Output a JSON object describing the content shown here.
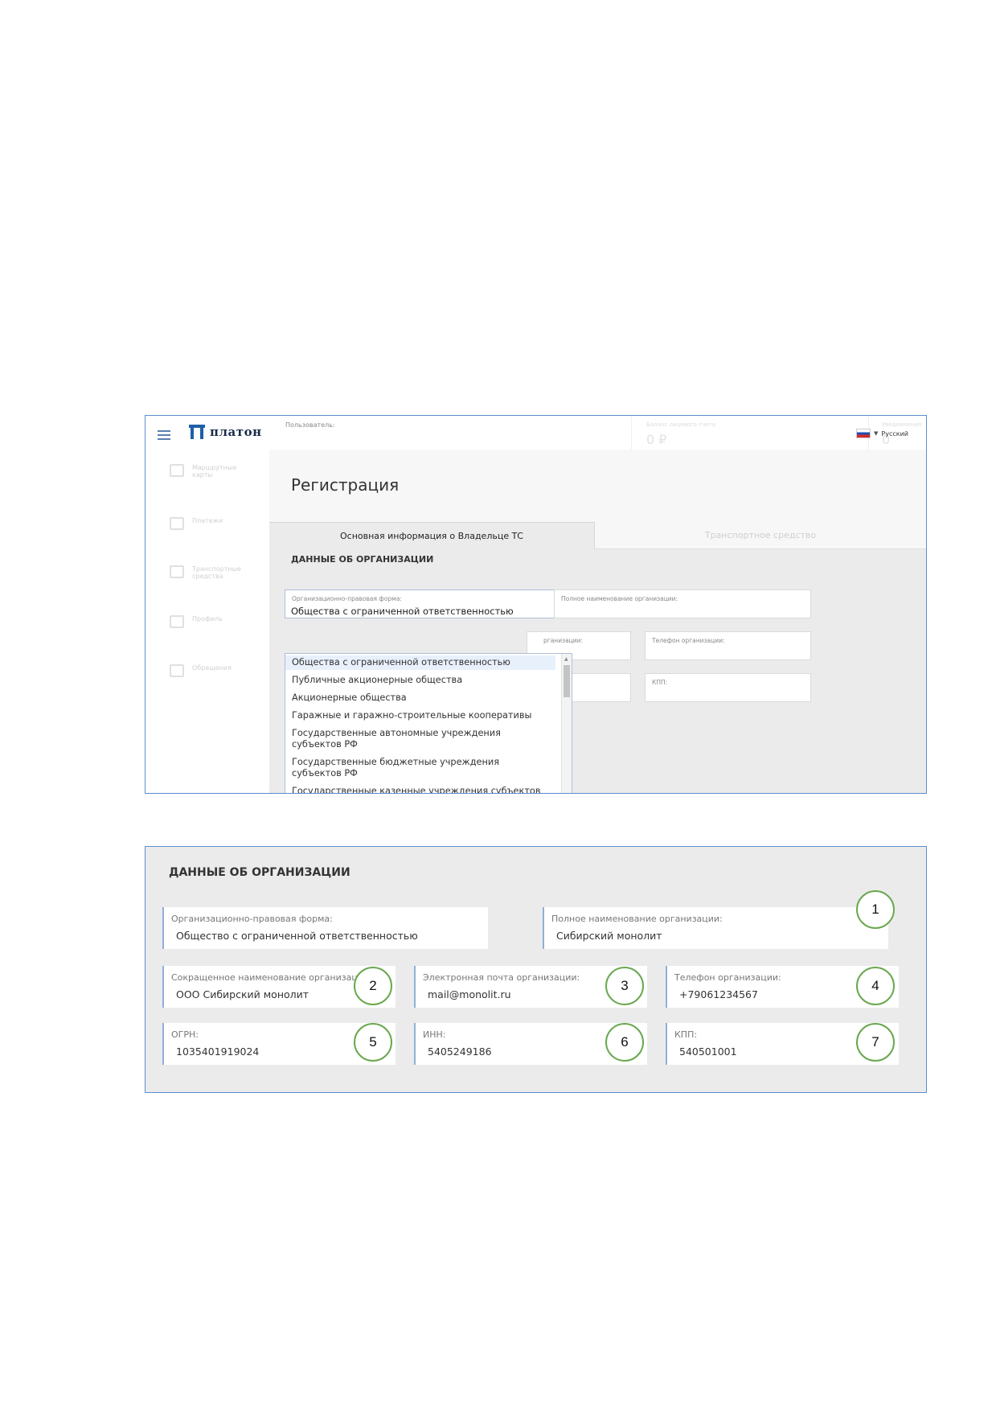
{
  "app": {
    "logo_text": "платон",
    "user_label": "Пользователь:",
    "balance_label": "Баланс лицевого счета",
    "balance_value": "0 ₽",
    "notifications_label": "Уведомления",
    "notifications_value": "0",
    "language": "Русский"
  },
  "sidebar": {
    "items": [
      {
        "label": "Маршрутные карты",
        "icon": "map-icon"
      },
      {
        "label": "Платежи",
        "icon": "wallet-icon"
      },
      {
        "label": "Транспортные средства",
        "icon": "truck-icon"
      },
      {
        "label": "Профиль",
        "icon": "profile-icon"
      },
      {
        "label": "Обращения",
        "icon": "message-icon"
      }
    ]
  },
  "page": {
    "title": "Регистрация",
    "tabs": [
      {
        "label": "Основная информация о Владельце ТС",
        "active": true
      },
      {
        "label": "Транспортное средство",
        "active": false
      }
    ],
    "section_title": "ДАННЫЕ ОБ ОРГАНИЗАЦИИ",
    "form": {
      "legal_form_label": "Организационно-правовая форма:",
      "legal_form_value": "Общества с ограниченной ответственностью",
      "full_name_label": "Полное наименование организации:",
      "email_label_partial": "рганизации:",
      "phone_label": "Телефон организации:",
      "kpp_label": "КПП:"
    },
    "dropdown_options": [
      "Общества с ограниченной ответственностью",
      "Публичные акционерные общества",
      "Акционерные общества",
      "Гаражные и гаражно-строительные кооперативы",
      "Государственные автономные учреждения субъектов РФ",
      "Государственные бюджетные учреждения субъектов РФ",
      "Государственные казенные учреждения субъектов РФ"
    ]
  },
  "filled": {
    "section_title": "ДАННЫЕ ОБ ОРГАНИЗАЦИИ",
    "fields": {
      "legal_form": {
        "label": "Организационно-правовая форма:",
        "value": "Общество с ограниченной ответственностью"
      },
      "full_name": {
        "label": "Полное наименование организации:",
        "value": "Сибирский монолит",
        "badge": "1"
      },
      "short_name": {
        "label": "Сокращенное наименование организации:",
        "value": "ООО Сибирский монолит",
        "badge": "2"
      },
      "email": {
        "label": "Электронная почта организации:",
        "value": "mail@monolit.ru",
        "badge": "3"
      },
      "phone": {
        "label": "Телефон организации:",
        "value": "+79061234567",
        "badge": "4"
      },
      "ogrn": {
        "label": "ОГРН:",
        "value": "1035401919024",
        "badge": "5"
      },
      "inn": {
        "label": "ИНН:",
        "value": "5405249186",
        "badge": "6"
      },
      "kpp": {
        "label": "КПП:",
        "value": "540501001",
        "badge": "7"
      }
    }
  }
}
